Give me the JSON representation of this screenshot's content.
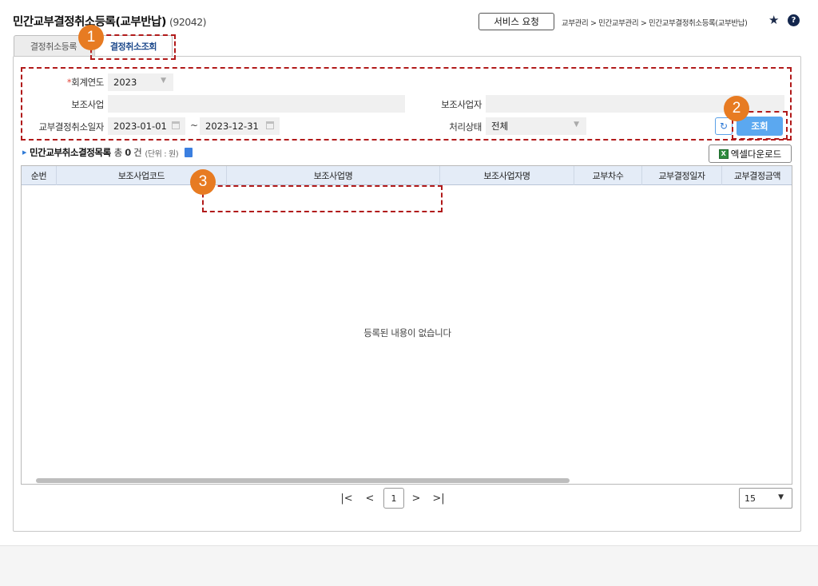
{
  "header": {
    "title": "민간교부결정취소등록(교부반납)",
    "code": "(92042)",
    "service_button": "서비스 요청",
    "breadcrumb": "교부관리 > 민간교부관리 > 민간교부결정취소등록(교부반납)",
    "star_icon": "★",
    "help_icon": "?"
  },
  "tabs": [
    {
      "label": "결정취소등록",
      "active": false
    },
    {
      "label": "결정취소조회",
      "active": true
    }
  ],
  "search": {
    "fiscal_year_required": "*",
    "fiscal_year_label": "회계연도",
    "fiscal_year_value": "2023",
    "subsidy_project_label": "보조사업",
    "subsidy_project_value": "",
    "subsidy_operator_label": "보조사업자",
    "subsidy_operator_value": "",
    "cancel_date_label": "교부결정취소일자",
    "date_from": "2023-01-01",
    "date_sep": "~",
    "date_to": "2023-12-31",
    "status_label": "처리상태",
    "status_value": "전체",
    "reset_icon": "↻",
    "search_button": "조회"
  },
  "list": {
    "title": "민간교부취소결정목록",
    "count_prefix": "총",
    "count_value": "0",
    "count_suffix": "건",
    "unit": "(단위 : 원)",
    "excel_button": "엑셀다운로드",
    "excel_icon_text": "X"
  },
  "grid": {
    "columns": [
      "순번",
      "보조사업코드",
      "보조사업명",
      "보조사업자명",
      "교부차수",
      "교부결정일자",
      "교부결정금액"
    ],
    "empty_message": "등록된 내용이 없습니다"
  },
  "pagination": {
    "first": "|<",
    "prev": "<",
    "current": "1",
    "next": ">",
    "last": ">|",
    "page_size": "15"
  },
  "annotations": [
    "1",
    "2",
    "3"
  ],
  "colors": {
    "accent_blue": "#5ba8f0",
    "callout_red": "#b11a1a",
    "badge_orange": "#e77b22",
    "grid_header": "#e4ecf7"
  }
}
